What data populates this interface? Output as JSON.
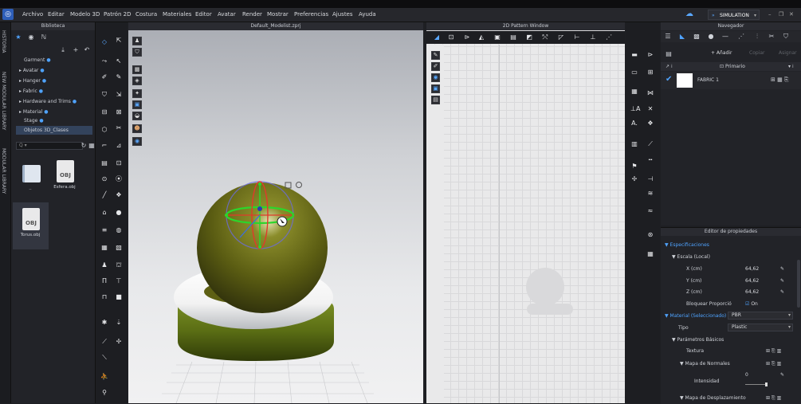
{
  "menu": {
    "items": [
      "Archivo",
      "Editar",
      "Modelo 3D",
      "Patrón 2D",
      "Costura",
      "Materiales",
      "Editor",
      "Avatar",
      "Render",
      "Mostrar",
      "Preferencias",
      "Ajustes",
      "Ayuda"
    ],
    "simulation": "SIMULATION"
  },
  "sidetabs": [
    "HISTORIA",
    "NEW MODULAR LIBRARY",
    "MODULAR LIBRARY"
  ],
  "library": {
    "title": "Biblioteca",
    "tree": [
      "Garment",
      "Avatar",
      "Hanger",
      "Fabric",
      "Hardware and Trims",
      "Material",
      "Stage",
      "Objetos 3D_Clases"
    ],
    "search_placeholder": "Q ▾",
    "files": [
      {
        "ext": "",
        "name": ".."
      },
      {
        "ext": "OBJ",
        "name": "Esfera.obj"
      },
      {
        "ext": "OBJ",
        "name": "Torus.obj"
      }
    ]
  },
  "viewport": {
    "title": "Default_Modelist.zprj"
  },
  "pattern": {
    "title": "2D Pattern Window"
  },
  "navigator": {
    "title": "Navegador",
    "add_label": "+ Añadir",
    "copy_label": "Copiar",
    "paste_label": "Asignar",
    "column_label": "Primario",
    "fabric_name": "FABRIC 1"
  },
  "props": {
    "title": "Editor de propiedades",
    "specs": "Especificaciones",
    "scale": "Escala (Local)",
    "x_label": "X (cm)",
    "x_value": "64,62",
    "y_label": "Y (cm)",
    "y_value": "64,62",
    "z_label": "Z (cm)",
    "z_value": "64,62",
    "lock_label": "Bloquear Proporció",
    "lock_value": "On",
    "material_label": "Material (Seleccionado)",
    "material_value": "PBR",
    "type_label": "Tipo",
    "type_value": "Plastic",
    "basic_params": "Parámetros Básicos",
    "texture": "Textura",
    "normal_map": "Mapa de Normales",
    "intensity": "Intensidad",
    "intensity_value": "0",
    "displacement_map": "Mapa de Desplazamiento"
  },
  "colors": {
    "accent": "#4fa3ff",
    "sphere": "#6b6d17",
    "torus": "#f2f2f2",
    "base": "#5a6d14",
    "gizmo_ring": "#2bd62b"
  }
}
